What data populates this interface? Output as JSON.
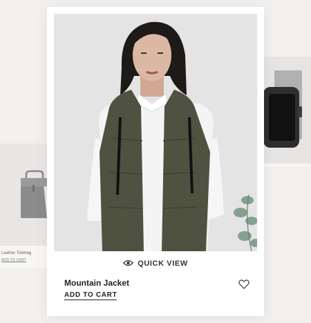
{
  "left_product": {
    "name": "Leather Totebag",
    "cta": "ADD TO CART"
  },
  "card": {
    "quick_view_label": "QUICK VIEW",
    "product_name": "Mountain Jacket",
    "cta": "ADD TO CART"
  },
  "colors": {
    "background": "#f1f0ef",
    "card": "#ffffff",
    "text": "#222222",
    "vest": "#4f5240"
  },
  "icons": [
    "eye-icon",
    "heart-icon"
  ]
}
